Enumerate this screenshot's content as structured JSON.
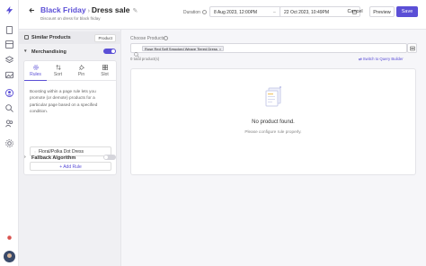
{
  "header": {
    "back_icon": "arrow-left-icon",
    "breadcrumb_parent": "Black Friday",
    "breadcrumb_separator": "›",
    "page_title": "Dress sale",
    "subtitle": "Discount on dress for black friday",
    "duration_label": "Duration",
    "start_date": "8 Aug 2023, 12:00PM",
    "end_date": "22 Oct 2023, 10:49PM",
    "date_separator": "–",
    "cancel_label": "Cancel",
    "preview_label": "Preview",
    "save_label": "Save"
  },
  "panel": {
    "similar_products_label": "Similar Products",
    "similar_products_tag": "Product",
    "merchandising_label": "Merchandising",
    "merchandising_enabled": true,
    "tabs": [
      {
        "label": "Rules",
        "icon": "gear-icon",
        "active": true
      },
      {
        "label": "Sort",
        "icon": "sort-icon",
        "active": false
      },
      {
        "label": "Pin",
        "icon": "pin-icon",
        "active": false
      },
      {
        "label": "Slot",
        "icon": "grid-icon",
        "active": false
      }
    ],
    "description": "Boosting within a page rule lets you promote (or demote) products for a particular page based on a specified condition.",
    "rule_item": "Floral/Polka Dot Dress",
    "add_rule_label": "+ Add Rule",
    "fallback_label": "Fallback Algorithm",
    "fallback_enabled": false
  },
  "main": {
    "choose_products_label": "Choose Products",
    "selected_chip": "Rose Red Self Smocked Weave Tiered Dress",
    "chip_remove": "×",
    "count_text": "0 total product(s)",
    "switch_label": "Switch to Query Builder",
    "empty_title": "No product found.",
    "empty_subtitle": "Please configure rule properly."
  },
  "colors": {
    "accent": "#5b4fd6",
    "background": "#f3f3f6"
  }
}
